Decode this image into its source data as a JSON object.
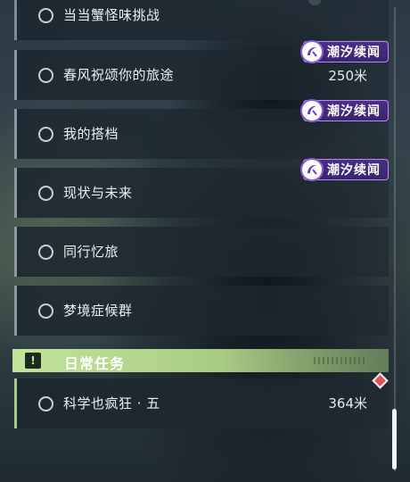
{
  "quests": [
    {
      "name": "当当蟹怪味挑战",
      "distance": "",
      "tag": ""
    },
    {
      "name": "春风祝颂你的旅途",
      "distance": "250米",
      "tag": "潮汐续闻"
    },
    {
      "name": "我的搭档",
      "distance": "",
      "tag": "潮汐续闻"
    },
    {
      "name": "现状与未来",
      "distance": "",
      "tag": "潮汐续闻"
    },
    {
      "name": "同行忆旅",
      "distance": "",
      "tag": ""
    },
    {
      "name": "梦境症候群",
      "distance": "",
      "tag": ""
    }
  ],
  "daily_section": {
    "icon_text": "!",
    "title": "日常任务"
  },
  "daily_quests": [
    {
      "name": "科学也疯狂 · 五",
      "distance": "364米"
    }
  ],
  "scrollbar": {
    "position_fraction": 1.0
  },
  "colors": {
    "tag_purple": "#3a2470",
    "tag_border": "#b78cf2",
    "daily_green": "#c2e39a",
    "marker_red": "#e3525a"
  },
  "icons": {
    "quest_status": "circle-outline-icon",
    "tag": "crescent-tide-icon",
    "daily": "exclamation-icon",
    "tracking": "diamond-marker-icon"
  }
}
